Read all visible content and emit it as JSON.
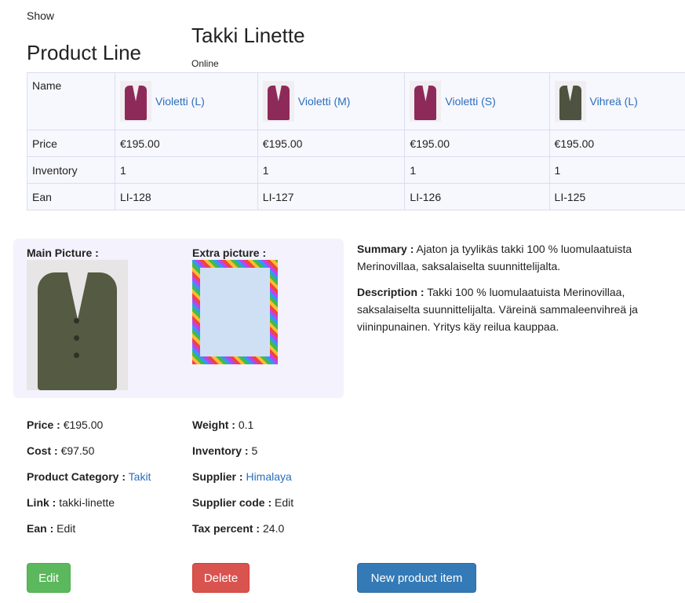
{
  "header": {
    "show": "Show",
    "product_line_title": "Product Line",
    "product_title": "Takki Linette",
    "status": "Online"
  },
  "product_line": {
    "row_labels": {
      "name": "Name",
      "price": "Price",
      "inventory": "Inventory",
      "ean": "Ean"
    },
    "variants": [
      {
        "name": "Violetti (L)",
        "price": "€195.00",
        "inventory": "1",
        "ean": "LI-128",
        "color": "#8e2a5a"
      },
      {
        "name": "Violetti (M)",
        "price": "€195.00",
        "inventory": "1",
        "ean": "LI-127",
        "color": "#8e2a5a"
      },
      {
        "name": "Violetti (S)",
        "price": "€195.00",
        "inventory": "1",
        "ean": "LI-126",
        "color": "#8e2a5a"
      },
      {
        "name": "Vihreä (L)",
        "price": "€195.00",
        "inventory": "1",
        "ean": "LI-125",
        "color": "#4e5240"
      }
    ]
  },
  "pictures": {
    "main_label": "Main Picture :",
    "extra_label": "Extra picture :"
  },
  "details": {
    "summary_label": "Summary :",
    "summary_text": "Ajaton ja tyylikäs takki 100 % luomulaatuista Merinovillaa, saksalaiselta suunnittelijalta.",
    "description_label": "Description :",
    "description_text": "Takki 100 % luomulaatuista Merinovillaa, saksalaiselta suunnittelijalta. Väreinä sammaleenvihreä ja viininpunainen. Yritys käy reilua kauppaa."
  },
  "fields": {
    "price_label": "Price :",
    "price_value": "€195.00",
    "cost_label": "Cost :",
    "cost_value": "€97.50",
    "category_label": "Product Category :",
    "category_value": "Takit",
    "link_label": "Link :",
    "link_value": "takki-linette",
    "ean_label": "Ean :",
    "ean_value": "Edit",
    "weight_label": "Weight :",
    "weight_value": "0.1",
    "inventory_label": "Inventory :",
    "inventory_value": "5",
    "supplier_label": "Supplier :",
    "supplier_value": "Himalaya",
    "supplier_code_label": "Supplier code :",
    "supplier_code_value": "Edit",
    "tax_label": "Tax percent :",
    "tax_value": "24.0"
  },
  "buttons": {
    "edit": "Edit",
    "delete": "Delete",
    "new_item": "New product item"
  },
  "colors": {
    "edit": "#5cb85c",
    "delete": "#d9534f",
    "primary": "#337ab7",
    "link": "#2a6ebb"
  }
}
